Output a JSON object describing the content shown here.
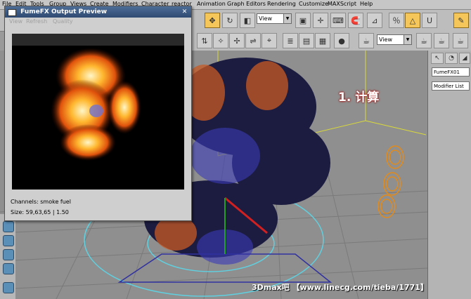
{
  "menu": [
    "File",
    "Edit",
    "Tools",
    "Group",
    "Views",
    "Create",
    "Modifiers",
    "Character",
    "reactor",
    "Animation",
    "Graph Editors",
    "Rendering",
    "Customize",
    "MAXScript",
    "Help"
  ],
  "toolbar": {
    "view_select": "View",
    "view_select2": "View"
  },
  "command_panel": {
    "object_name": "FumeFX01",
    "modifier_list": "Modifier List"
  },
  "preview_window": {
    "title": "FumeFX Output Preview",
    "menu": [
      "View",
      "Refresh",
      "Quality"
    ],
    "channels": "Channels: smoke fuel",
    "size": "Size: 59,63,65 | 1.50"
  },
  "annotation": "1. 计算",
  "watermark": "3Dmax吧 【www.linecg.com/tieba/1771】",
  "colors": {
    "accent": "#f5c65a",
    "title_bar": "#3b5a86",
    "viewport_bg": "#8f8f8f"
  }
}
